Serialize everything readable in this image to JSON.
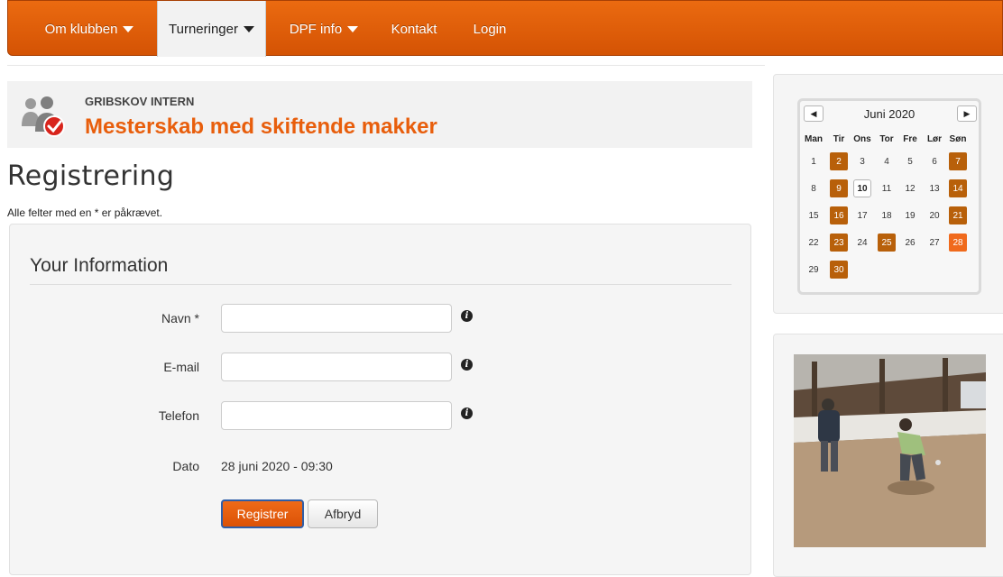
{
  "nav": {
    "items": [
      {
        "label": "Om klubben",
        "has_caret": true
      },
      {
        "label": "Turneringer",
        "has_caret": true,
        "active": true
      },
      {
        "label": "DPF info",
        "has_caret": true
      },
      {
        "label": "Kontakt",
        "has_caret": false
      },
      {
        "label": "Login",
        "has_caret": false
      }
    ]
  },
  "tournament": {
    "subtitle": "GRIBSKOV INTERN",
    "title": "Mesterskab med skiftende makker",
    "icon": "users-check-icon"
  },
  "page": {
    "title": "Registrering",
    "required_note": "Alle felter med en * er påkrævet."
  },
  "form": {
    "legend": "Your Information",
    "fields": [
      {
        "label": "Navn *",
        "value": "",
        "help_icon": "info-icon"
      },
      {
        "label": "E-mail",
        "value": "",
        "help_icon": "info-icon"
      },
      {
        "label": "Telefon",
        "value": "",
        "help_icon": "info-icon"
      }
    ],
    "date_label": "Dato",
    "date_value": "28 juni 2020 - 09:30",
    "submit_label": "Registrer",
    "cancel_label": "Afbryd"
  },
  "calendar": {
    "month": "Juni 2020",
    "prev_icon": "◀",
    "next_icon": "▶",
    "weekdays": [
      "Man",
      "Tir",
      "Ons",
      "Tor",
      "Fre",
      "Lør",
      "Søn"
    ],
    "weeks": [
      [
        "1",
        "2",
        "3",
        "4",
        "5",
        "6",
        "7"
      ],
      [
        "8",
        "9",
        "10",
        "11",
        "12",
        "13",
        "14"
      ],
      [
        "15",
        "16",
        "17",
        "18",
        "19",
        "20",
        "21"
      ],
      [
        "22",
        "23",
        "24",
        "25",
        "26",
        "27",
        "28"
      ],
      [
        "29",
        "30",
        "",
        "",
        "",
        "",
        ""
      ]
    ],
    "event_days": [
      "2",
      "7",
      "9",
      "14",
      "16",
      "21",
      "23",
      "25",
      "30"
    ],
    "selected_day": "28",
    "today": "10",
    "colors": {
      "event": "#b8600a",
      "selected": "#f06a1c"
    }
  },
  "photo": {
    "icon": "petanque-photo"
  },
  "colors": {
    "brand": "#e85e0c",
    "nav_bg": "#e05a06"
  }
}
